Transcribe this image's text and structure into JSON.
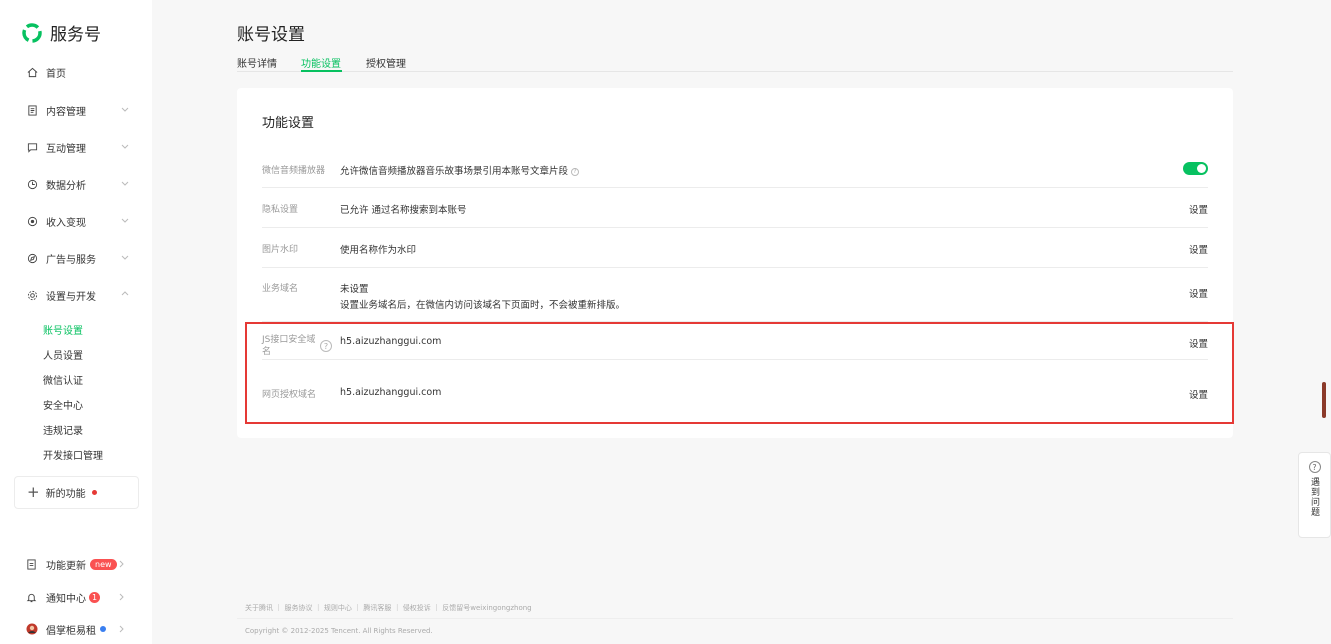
{
  "app": {
    "name": "服务号"
  },
  "sidebar": {
    "home": "首页",
    "menus": [
      {
        "label": "内容管理"
      },
      {
        "label": "互动管理"
      },
      {
        "label": "数据分析"
      },
      {
        "label": "收入变现"
      },
      {
        "label": "广告与服务"
      },
      {
        "label": "设置与开发"
      }
    ],
    "sub_items": [
      "账号设置",
      "人员设置",
      "微信认证",
      "安全中心",
      "违规记录",
      "开发接口管理"
    ],
    "new_feature": "新的功能",
    "bottom": {
      "updates": "功能更新",
      "updates_badge": "new",
      "notify": "通知中心",
      "notify_count": "1",
      "user": "倡掌柜易租"
    }
  },
  "page": {
    "title": "账号设置",
    "tabs": [
      "账号详情",
      "功能设置",
      "授权管理"
    ]
  },
  "card": {
    "title": "功能设置",
    "rows": [
      {
        "label": "微信音频播放器",
        "value": "允许微信音频播放器音乐故事场景引用本账号文章片段"
      },
      {
        "label": "隐私设置",
        "value": "已允许 通过名称搜索到本账号",
        "action": "设置"
      },
      {
        "label": "图片水印",
        "value": "使用名称作为水印",
        "action": "设置"
      },
      {
        "label": "业务域名",
        "value": "未设置",
        "sub": "设置业务域名后，在微信内访问该域名下页面时，不会被重新排版。",
        "action": "设置"
      },
      {
        "label": "JS接口安全域名",
        "value": "h5.aizuzhanggui.com",
        "action": "设置"
      },
      {
        "label": "网页授权域名",
        "value": "h5.aizuzhanggui.com",
        "action": "设置"
      }
    ]
  },
  "footer": {
    "links": "关于腾讯 ｜ 服务协议 ｜ 规则中心 ｜ 腾讯客服 ｜ 侵权投诉 ｜ 反馈留号weixingongzhong",
    "copyright": "Copyright © 2012-2025 Tencent. All Rights Reserved."
  },
  "help_widget": {
    "label": "遇到问题"
  },
  "colors": {
    "accent": "#07c160",
    "highlight": "#e53935"
  }
}
